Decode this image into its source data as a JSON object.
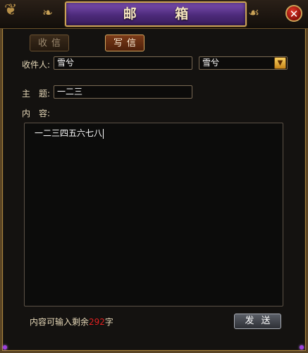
{
  "window": {
    "title": "邮 箱",
    "close_icon": "close-icon"
  },
  "tabs": [
    {
      "label": "收信",
      "active": false
    },
    {
      "label": "写信",
      "active": true
    }
  ],
  "form": {
    "recipient_label": "收件人:",
    "recipient_value": "雪兮",
    "recipient_select_value": "雪兮",
    "subject_label": "主　题:",
    "subject_value": "一二三",
    "content_label": "内　容:",
    "content_value": "一二三四五六七八"
  },
  "footer": {
    "remain_prefix": "内容可输入剩余",
    "remain_count": "292",
    "remain_suffix": "字",
    "send_label": "发送"
  },
  "colors": {
    "accent_purple": "#5a3290",
    "gold_border": "#c9a257",
    "count_red": "#e02020"
  }
}
